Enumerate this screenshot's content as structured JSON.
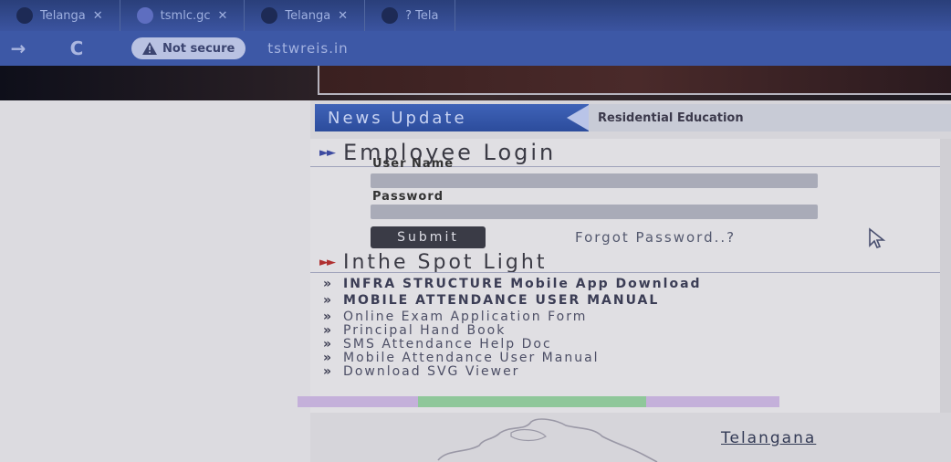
{
  "browser": {
    "tabs": [
      {
        "title": "Telanga",
        "close": "✕"
      },
      {
        "title": "tsmlc.gc",
        "close": "✕"
      },
      {
        "title": "Telanga",
        "close": "✕"
      },
      {
        "title": "? Tela",
        "close": ""
      }
    ],
    "nav": {
      "back": "→",
      "reload": "C"
    },
    "security_label": "Not secure",
    "url": "tstwreis.in"
  },
  "news": {
    "label": "News Update",
    "ticker": "Residential Education"
  },
  "login": {
    "title": "Employee Login",
    "username_label": "User Name",
    "password_label": "Password",
    "submit_label": "Submit",
    "forgot_label": "Forgot Password..?"
  },
  "spotlight": {
    "title": "Inthe Spot Light",
    "items": [
      {
        "arrow": "»",
        "text": "INFRA STRUCTURE Mobile App Download"
      },
      {
        "arrow": "»",
        "text": "MOBILE ATTENDANCE USER MANUAL"
      },
      {
        "arrow": "»",
        "text": "Online Exam Application Form"
      },
      {
        "arrow": "»",
        "text": "Principal Hand Book"
      },
      {
        "arrow": "»",
        "text": "SMS Attendance Help Doc"
      },
      {
        "arrow": "»",
        "text": "Mobile Attendance User Manual"
      },
      {
        "arrow": "»",
        "text": "Download SVG Viewer"
      }
    ]
  },
  "footer": {
    "telangana_link": "Telangana"
  },
  "colors": {
    "tab_bar": "#2a3f7a",
    "news_label": "#2c4c9c",
    "submit": "#3a3b46"
  }
}
